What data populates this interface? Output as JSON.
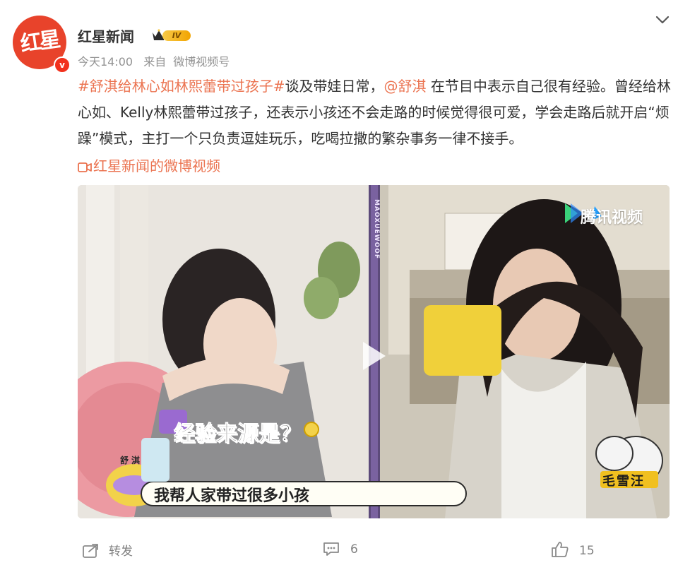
{
  "account": {
    "logo_text": "红星",
    "verified_mark": "v",
    "name": "红星新闻",
    "level_label": "IV",
    "level_icon": "crown-icon"
  },
  "meta": {
    "time": "今天14:00",
    "source_prefix": "来自",
    "source": "微博视频号"
  },
  "post": {
    "hashtag": "#舒淇给林心如林熙蕾带过孩子#",
    "text_1": "谈及带娃日常，",
    "mention": "@舒淇",
    "text_2": " 在节目中表示自己很有经验。曾经给林心如、Kelly林熙蕾带过孩子，还表示小孩还不会走路的时候觉得很可爱，学会走路后就开启“烦躁”模式，主打一个只负责逗娃玩乐，吃喝拉撒的繁杂事务一律不接手。",
    "video_link": "红星新闻的微博视频"
  },
  "video": {
    "watermark": "腾讯视频",
    "side_strip": "MAOXUEWOOF",
    "caption_question": "经验来源是？",
    "speaker_tag": "舒淇",
    "subtitle": "我帮人家带过很多小孩",
    "show_logo": "毛雪汪",
    "accent": "#f0c020"
  },
  "actions": {
    "repost_label": "转发",
    "comments_count": "6",
    "likes_count": "15"
  }
}
